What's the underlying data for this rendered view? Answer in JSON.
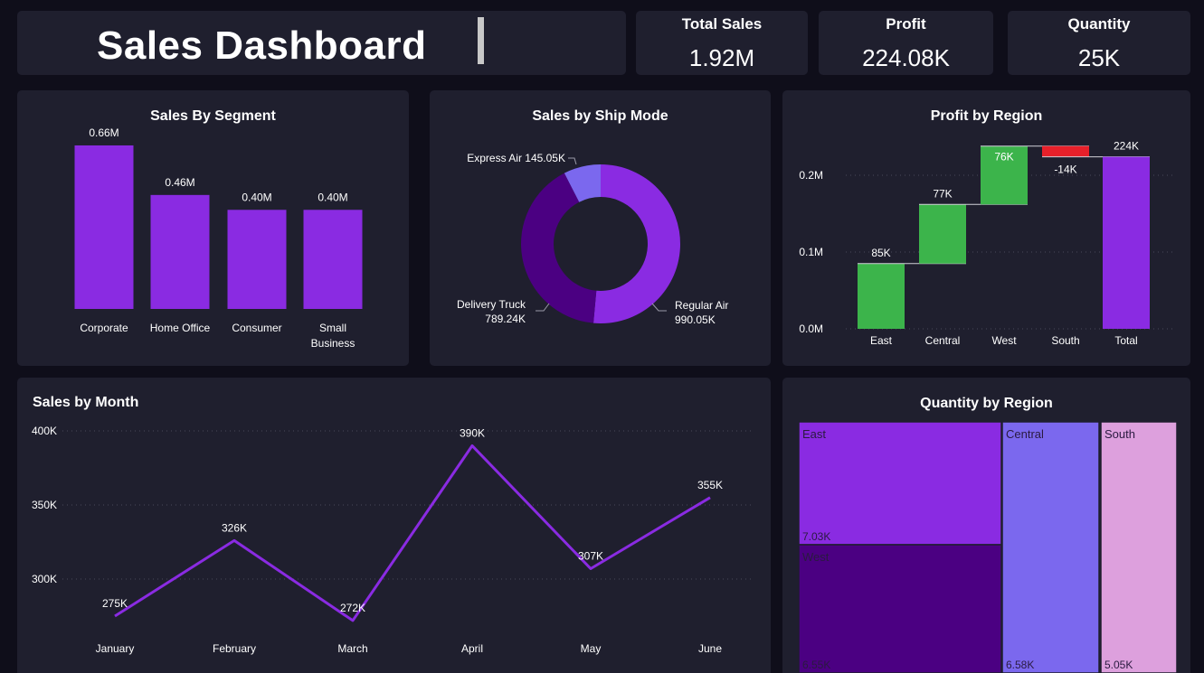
{
  "header": {
    "title": "Sales Dashboard"
  },
  "kpis": {
    "total_sales": {
      "label": "Total Sales",
      "value": "1.92M"
    },
    "profit": {
      "label": "Profit",
      "value": "224.08K"
    },
    "quantity": {
      "label": "Quantity",
      "value": "25K"
    }
  },
  "colors": {
    "background": "#0f0e1a",
    "card": "#1f1f2e",
    "purple": "#8a2be2",
    "dark_purple": "#4b0082",
    "medium_purple": "#7b68ee",
    "plum": "#dda0dd",
    "green": "#3cb44b",
    "red": "#e8202a"
  },
  "chart_data": [
    {
      "id": "segment",
      "type": "bar",
      "title": "Sales By Segment",
      "categories": [
        "Corporate",
        "Home Office",
        "Consumer",
        "Small Business"
      ],
      "values": [
        0.66,
        0.46,
        0.4,
        0.4
      ],
      "data_labels": [
        "0.66M",
        "0.46M",
        "0.40M",
        "0.40M"
      ],
      "ylim": [
        0,
        0.7
      ]
    },
    {
      "id": "shipmode",
      "type": "pie",
      "title": "Sales by Ship Mode",
      "labels": [
        "Regular Air",
        "Delivery Truck",
        "Express Air"
      ],
      "values": [
        990.05,
        789.24,
        145.05
      ],
      "data_labels": [
        "990.05K",
        "789.24K",
        "145.05K"
      ],
      "colors": [
        "#8a2be2",
        "#4b0082",
        "#7b68ee"
      ]
    },
    {
      "id": "region_profit",
      "type": "bar",
      "subtype": "waterfall",
      "title": "Profit by Region",
      "categories": [
        "East",
        "Central",
        "West",
        "South",
        "Total"
      ],
      "values": [
        85,
        77,
        76,
        -14,
        224
      ],
      "data_labels": [
        "85K",
        "77K",
        "76K",
        "-14K",
        "224K"
      ],
      "yticks": [
        "0.0M",
        "0.1M",
        "0.2M"
      ],
      "ytick_values": [
        0,
        100,
        200
      ],
      "ylim": [
        0,
        240
      ],
      "grid": true
    },
    {
      "id": "month",
      "type": "line",
      "title": "Sales by Month",
      "categories": [
        "January",
        "February",
        "March",
        "April",
        "May",
        "June"
      ],
      "values": [
        275,
        326,
        272,
        390,
        307,
        355
      ],
      "data_labels": [
        "275K",
        "326K",
        "272K",
        "390K",
        "307K",
        "355K"
      ],
      "yticks": [
        "300K",
        "350K",
        "400K"
      ],
      "ytick_values": [
        300,
        350,
        400
      ],
      "ylim": [
        265,
        400
      ],
      "grid": true
    },
    {
      "id": "qty_region",
      "type": "treemap",
      "title": "Quantity by Region",
      "items": [
        {
          "label": "East",
          "value": 7.03,
          "value_label": "7.03K",
          "color": "#8a2be2"
        },
        {
          "label": "West",
          "value": 6.55,
          "value_label": "6.55K",
          "color": "#4b0082"
        },
        {
          "label": "Central",
          "value": 6.58,
          "value_label": "6.58K",
          "color": "#7b68ee"
        },
        {
          "label": "South",
          "value": 5.05,
          "value_label": "5.05K",
          "color": "#dda0dd"
        }
      ]
    }
  ]
}
